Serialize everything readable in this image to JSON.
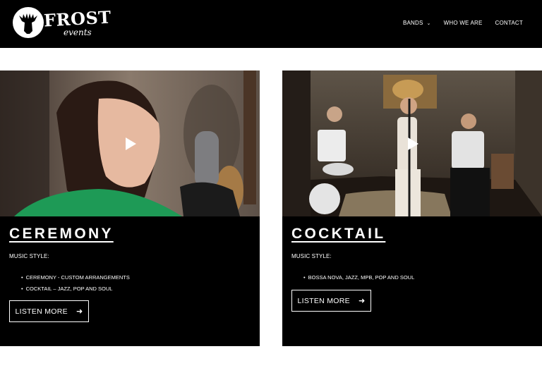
{
  "header": {
    "logo": {
      "word": "FROST",
      "sub": "events"
    },
    "nav": [
      {
        "label": "BANDS",
        "has_dropdown": true
      },
      {
        "label": "WHO WE ARE"
      },
      {
        "label": "CONTACT"
      }
    ]
  },
  "cards": [
    {
      "title": "CEREMONY",
      "style_label": "MUSIC STYLE:",
      "bullets": [
        "CEREMONY - CUSTOM ARRANGEMENTS",
        "COCKTAIL – JAZZ, POP AND SOUL"
      ],
      "button": "LISTEN MORE"
    },
    {
      "title": "COCKTAIL",
      "style_label": "MUSIC STYLE:",
      "bullets": [
        "BOSSA NOVA, JAZZ, MPB, POP AND SOUL"
      ],
      "button": "LISTEN MORE"
    }
  ],
  "icons": {
    "play": "play-icon",
    "arrow": "arrow-right-icon",
    "chevron": "chevron-down-icon"
  },
  "colors": {
    "background": "#ffffff",
    "header": "#000000",
    "card": "#000000",
    "text": "#ffffff"
  }
}
